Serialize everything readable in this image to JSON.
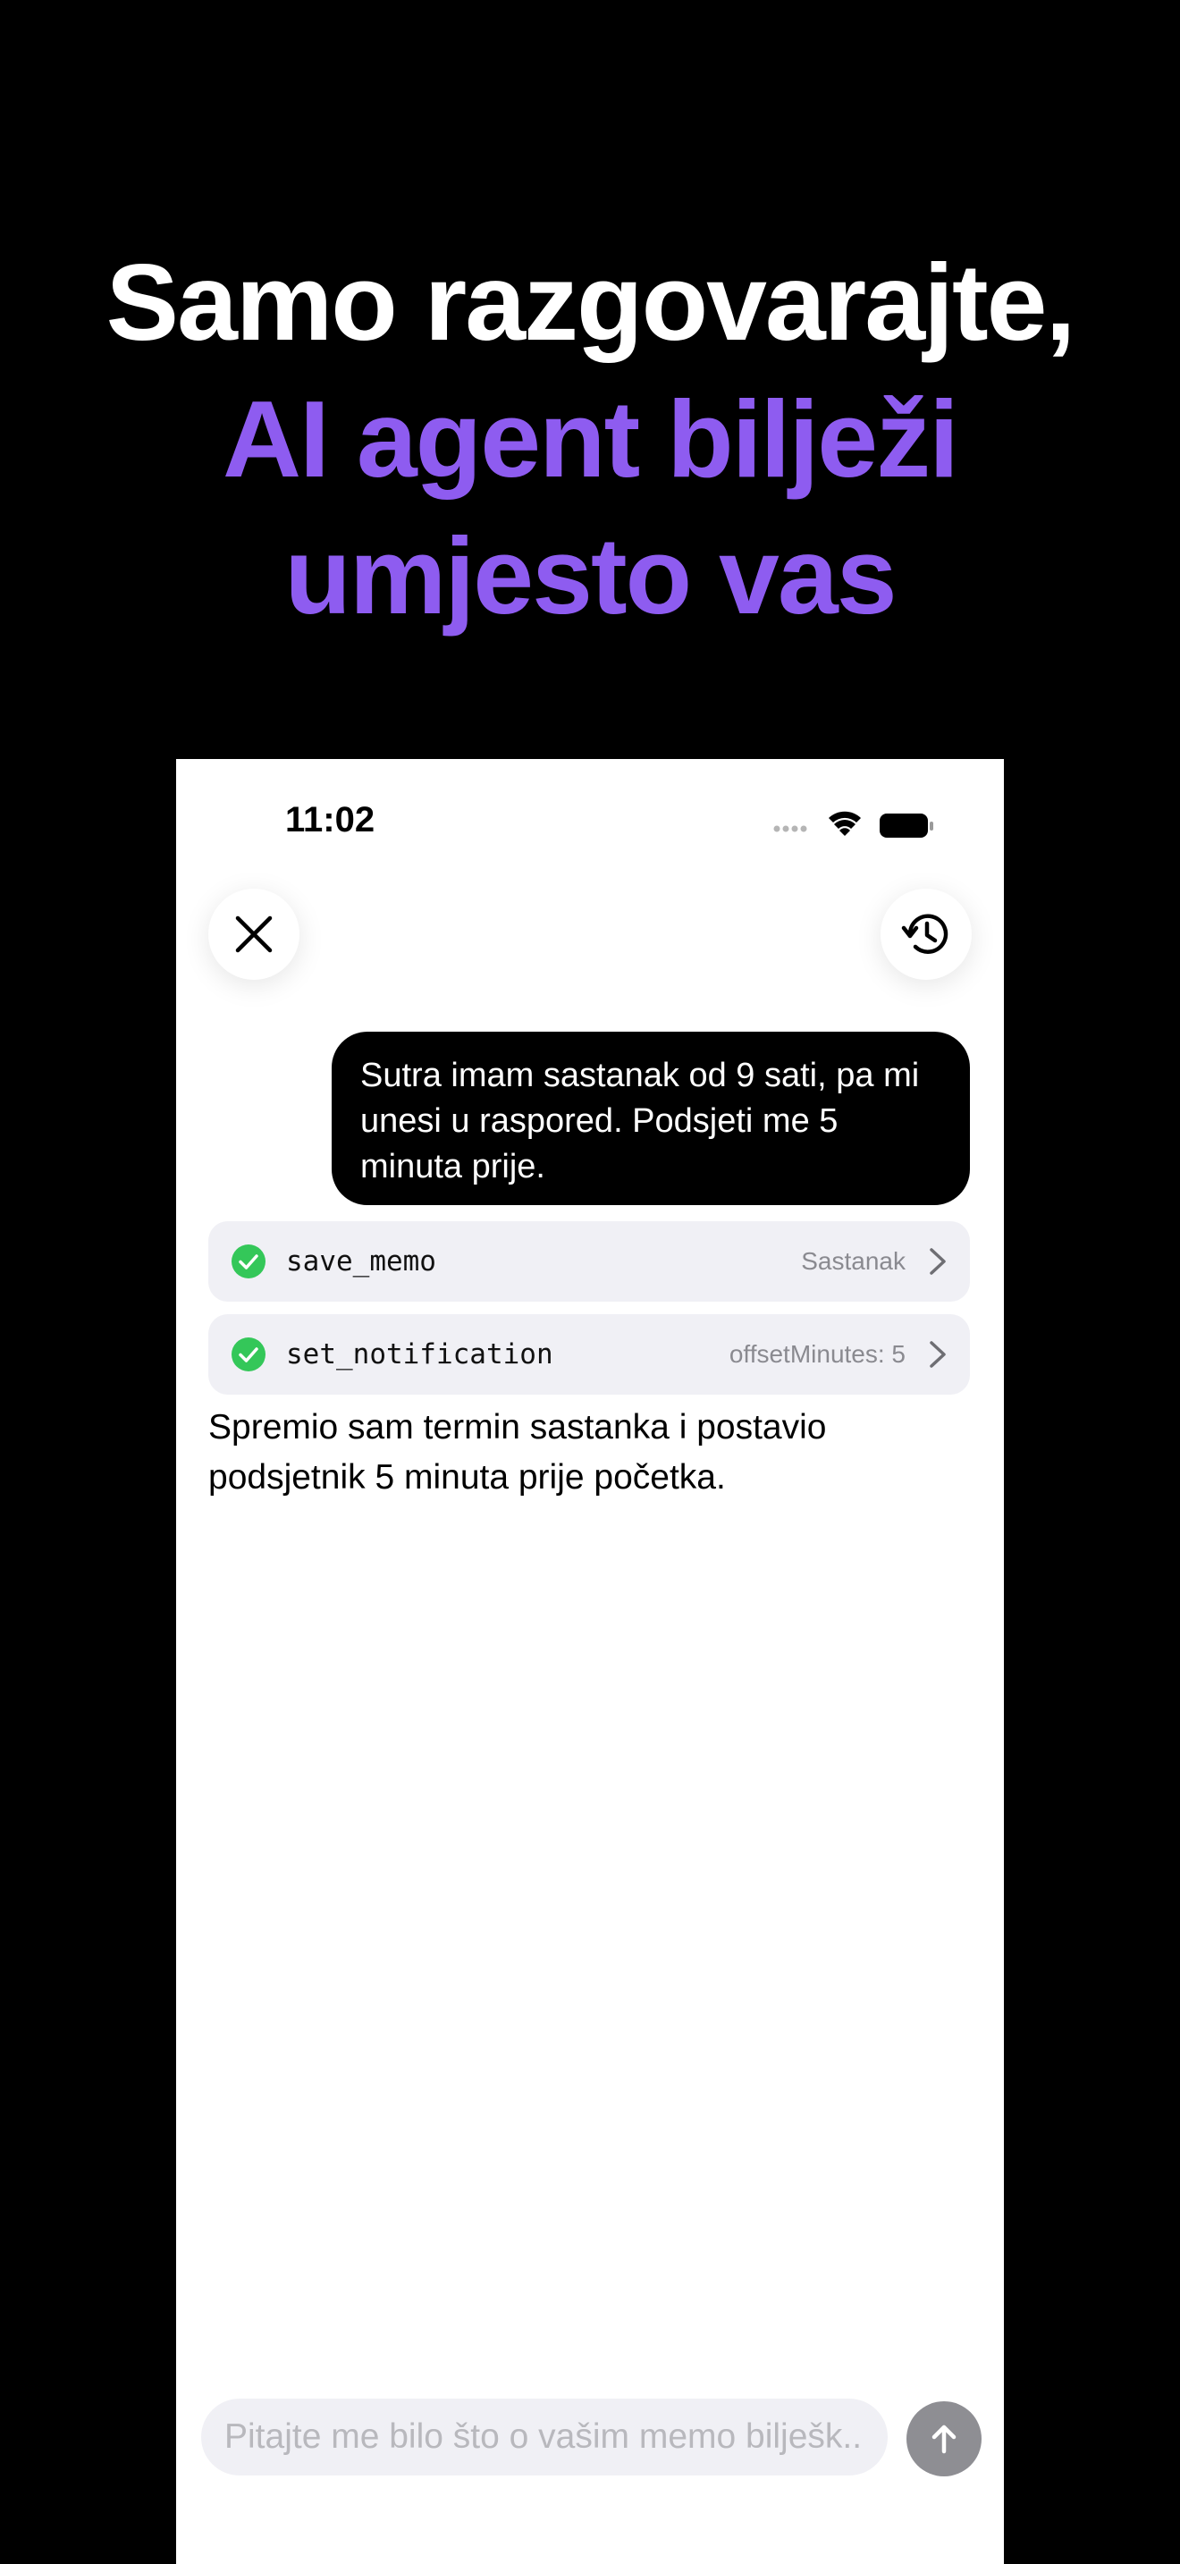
{
  "headline": {
    "line1": "Samo razgovarajte,",
    "line2": "AI agent bilježi",
    "line3": "umjesto vas",
    "accent_color": "#8e5cf0"
  },
  "status_bar": {
    "time": "11:02",
    "icons": [
      "cellular-signal-icon",
      "wifi-icon",
      "battery-icon"
    ]
  },
  "toolbar": {
    "close_icon": "close-icon",
    "history_icon": "history-icon"
  },
  "conversation": {
    "user_message": "Sutra imam sastanak od 9 sati, pa mi unesi u raspored. Podsjeti me 5 minuta prije.",
    "tool_calls": [
      {
        "name": "save_memo",
        "value": "Sastanak",
        "status": "success"
      },
      {
        "name": "set_notification",
        "value": "offsetMinutes: 5",
        "status": "success"
      }
    ],
    "assistant_message": "Spremio sam termin sastanka i postavio podsjetnik 5 minuta prije početka."
  },
  "composer": {
    "placeholder": "Pitajte me bilo što o vašim memo bilješk...",
    "value": "",
    "send_icon": "arrow-up-icon"
  },
  "colors": {
    "background": "#000000",
    "screen": "#ffffff",
    "check": "#34c759",
    "send_button": "#8e8e93",
    "tool_row": "#f0f0f5"
  }
}
